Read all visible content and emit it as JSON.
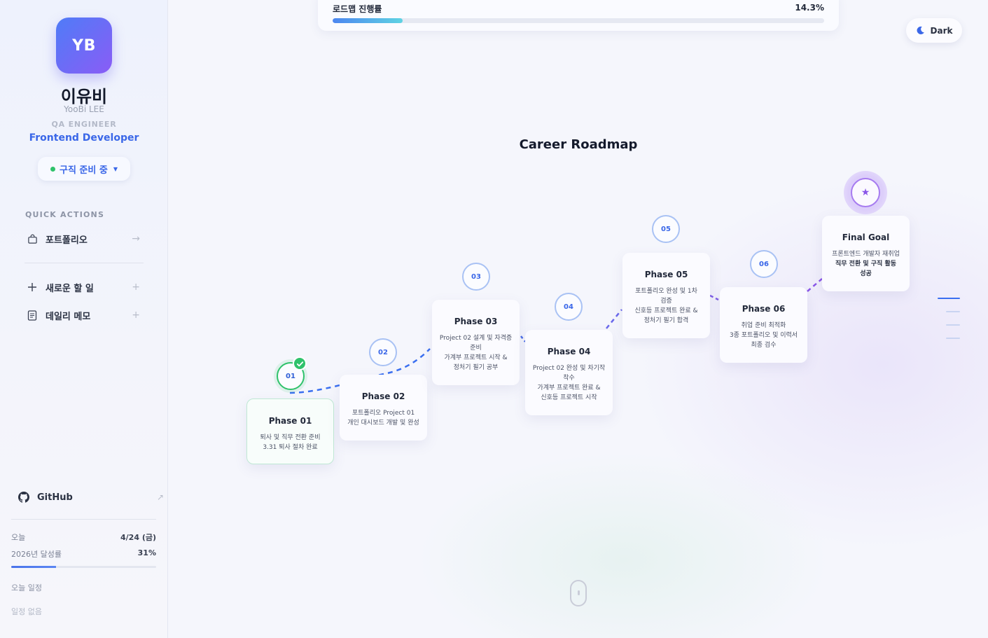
{
  "profile": {
    "initials": "YB",
    "name": "이유비",
    "name_en": "YooBi LEE",
    "role_sub": "QA ENGINEER",
    "role_main": "Frontend Developer",
    "status": "구직 준비 중"
  },
  "sidebar": {
    "quick_actions_title": "QUICK ACTIONS",
    "portfolio": "포트폴리오",
    "new_todo": "새로운 할 일",
    "daily_memo": "데일리 메모",
    "github": "GitHub",
    "today_label": "오늘",
    "today_value": "4/24 (금)",
    "year_label": "2026년 달성률",
    "year_value": "31%",
    "year_progress": 31,
    "schedule_label": "오늘 일정",
    "schedule_empty": "일정 없음"
  },
  "roadmap": {
    "progress_label": "로드맵 진행률",
    "progress_value": "14.3%",
    "progress": 14.3,
    "title": "Career Roadmap",
    "theme_button": "Dark",
    "phases": [
      {
        "num": "01",
        "title": "Phase 01",
        "desc": [
          "퇴사 및 직무 전환 준비",
          "3.31 퇴사 절차 완료"
        ],
        "done": true
      },
      {
        "num": "02",
        "title": "Phase 02",
        "desc": [
          "포트폴리오 Project 01",
          "개인 대시보드 개발 및 완성"
        ],
        "done": false
      },
      {
        "num": "03",
        "title": "Phase 03",
        "desc": [
          "Project 02 설계 및 자격증",
          "준비",
          "가계부 프로젝트 시작 &",
          "정처기 필기 공부"
        ],
        "done": false
      },
      {
        "num": "04",
        "title": "Phase 04",
        "desc": [
          "Project 02 완성 및 차기작",
          "착수",
          "가계부 프로젝트 완료 &",
          "신호등 프로젝트 시작"
        ],
        "done": false
      },
      {
        "num": "05",
        "title": "Phase 05",
        "desc": [
          "포트폴리오 완성 및 1차",
          "검증",
          "신호등 프로젝트 완료 &",
          "정처기 필기 합격"
        ],
        "done": false
      },
      {
        "num": "06",
        "title": "Phase 06",
        "desc": [
          "취업 준비 최적화",
          "3종 포트폴리오 및 이력서",
          "최종 검수"
        ],
        "done": false
      }
    ],
    "final": {
      "title": "Final Goal",
      "desc": [
        "프론트엔드 개발자 재취업",
        "직무 전환 및 구직 활동",
        "성공"
      ]
    }
  },
  "colors": {
    "accent": "#3a67e8",
    "success": "#2fc26b",
    "goal": "#8a55e8"
  }
}
